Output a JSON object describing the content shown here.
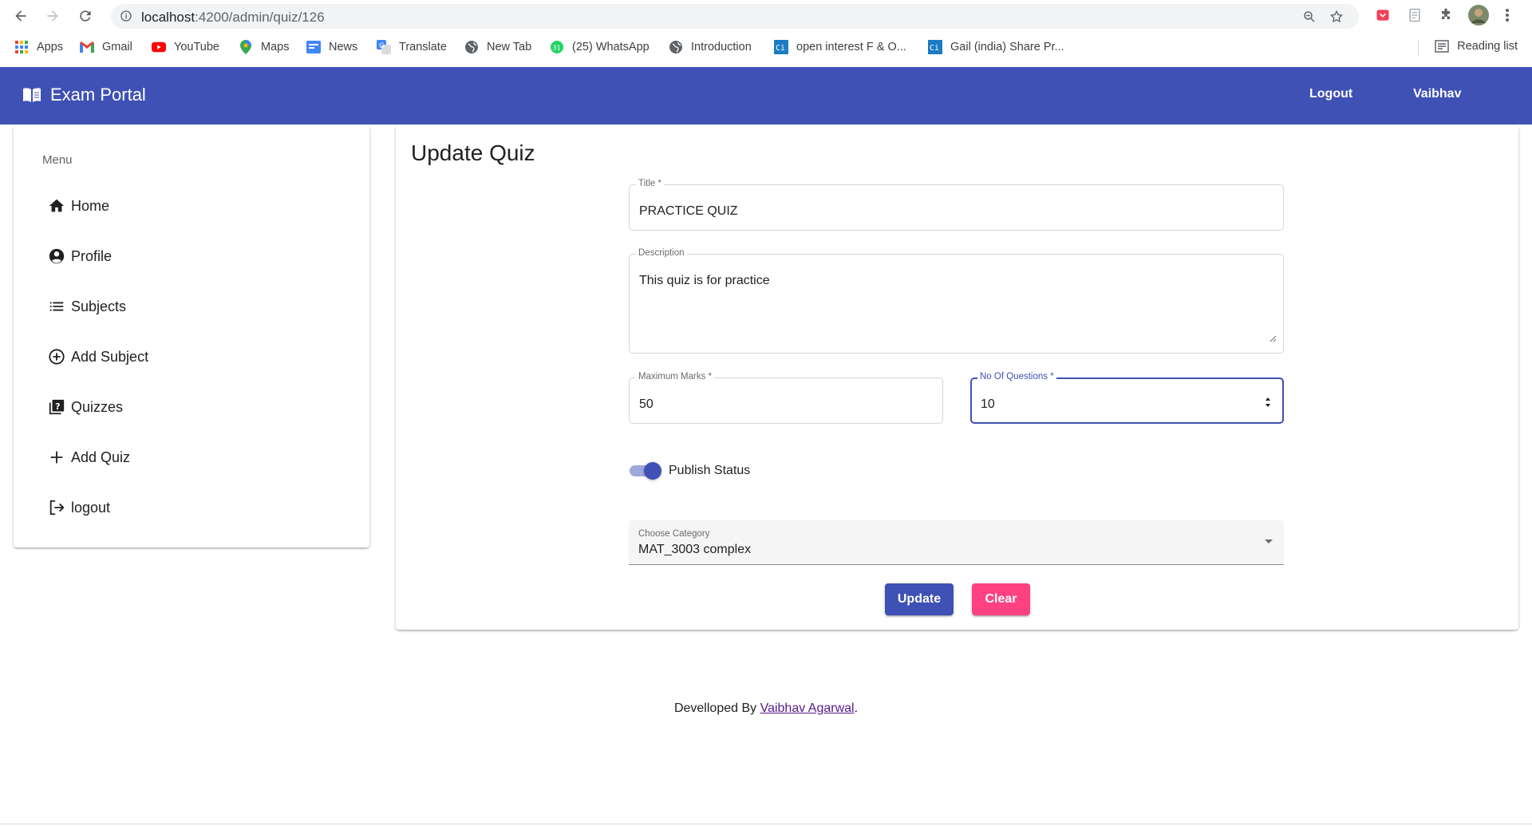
{
  "browser": {
    "url_host": "localhost",
    "url_path": ":4200/admin/quiz/126",
    "bookmarks": [
      "Apps",
      "Gmail",
      "YouTube",
      "Maps",
      "News",
      "Translate",
      "New Tab",
      "(25) WhatsApp",
      "Introduction",
      "open interest F & O...",
      "Gail (india) Share Pr..."
    ],
    "reading_list": "Reading list"
  },
  "toolbar": {
    "brand": "Exam Portal",
    "logout": "Logout",
    "user": "Vaibhav",
    "color": "#3f51b5"
  },
  "sidebar": {
    "heading": "Menu",
    "items": [
      {
        "label": "Home",
        "icon": "home-icon"
      },
      {
        "label": "Profile",
        "icon": "account-circle-icon"
      },
      {
        "label": "Subjects",
        "icon": "list-icon"
      },
      {
        "label": "Add Subject",
        "icon": "add-circle-outline-icon"
      },
      {
        "label": "Quizzes",
        "icon": "quiz-icon"
      },
      {
        "label": "Add Quiz",
        "icon": "add-icon"
      },
      {
        "label": "logout",
        "icon": "logout-icon"
      }
    ]
  },
  "form": {
    "title": "Update Quiz",
    "title_field": {
      "label": "Title *",
      "value": "PRACTICE QUIZ"
    },
    "description": {
      "label": "Description",
      "value": "This quiz is for practice"
    },
    "max_marks": {
      "label": "Maximum Marks *",
      "value": "50"
    },
    "num_questions": {
      "label": "No Of Questions *",
      "value": "10"
    },
    "publish": {
      "label": "Publish Status",
      "checked": true
    },
    "category": {
      "label": "Choose Category",
      "value": "MAT_3003 complex"
    },
    "update_button": "Update",
    "clear_button": "Clear",
    "update_color": "#3f51b5",
    "clear_color": "#ff4081"
  },
  "footer": {
    "prefix": "Develloped By",
    "author": "Vaibhav Agarwal",
    "suffix": "."
  }
}
